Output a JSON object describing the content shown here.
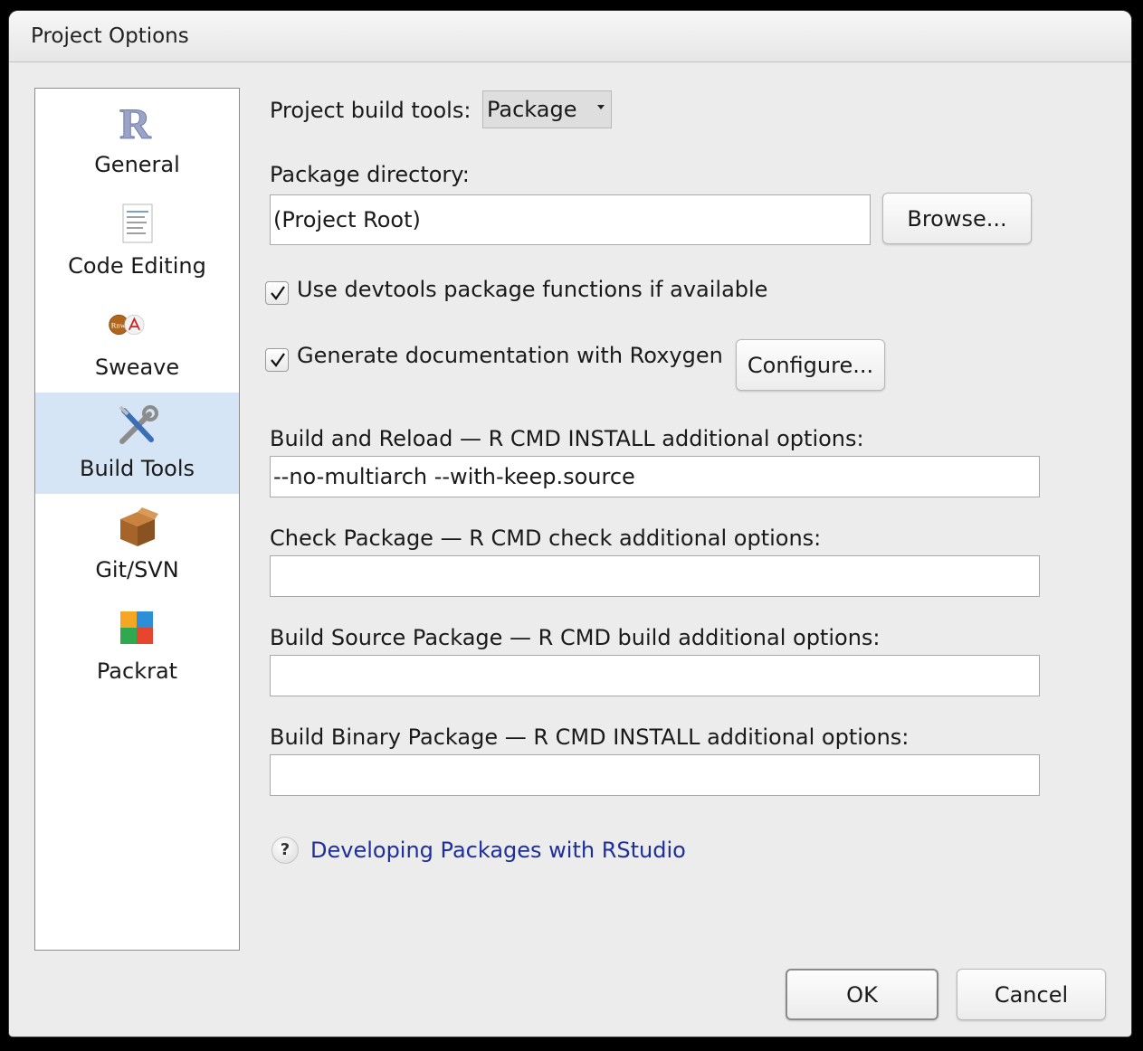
{
  "window": {
    "title": "Project Options"
  },
  "sidebar": {
    "items": [
      {
        "label": "General",
        "icon": "r-logo-icon",
        "selected": false
      },
      {
        "label": "Code Editing",
        "icon": "document-icon",
        "selected": false
      },
      {
        "label": "Sweave",
        "icon": "sweave-icon",
        "selected": false
      },
      {
        "label": "Build Tools",
        "icon": "tools-icon",
        "selected": true
      },
      {
        "label": "Git/SVN",
        "icon": "box-icon",
        "selected": false
      },
      {
        "label": "Packrat",
        "icon": "packrat-icon",
        "selected": false
      }
    ],
    "icon_texts": {
      "r": "R",
      "rnw": "Rnw"
    }
  },
  "build_tools": {
    "project_build_tools_label": "Project build tools:",
    "project_build_tools_value": "Package",
    "package_directory_label": "Package directory:",
    "package_directory_value": "(Project Root)",
    "browse_label": "Browse...",
    "use_devtools_label": "Use devtools package functions if available",
    "use_devtools_checked": true,
    "roxygen_label": "Generate documentation with Roxygen",
    "roxygen_checked": true,
    "configure_label": "Configure...",
    "build_reload_label": "Build and Reload — R CMD INSTALL additional options:",
    "build_reload_value": "--no-multiarch --with-keep.source",
    "check_label": "Check Package — R CMD check additional options:",
    "check_value": "",
    "build_source_label": "Build Source Package — R CMD build additional options:",
    "build_source_value": "",
    "build_binary_label": "Build Binary Package — R CMD INSTALL additional options:",
    "build_binary_value": "",
    "help_symbol": "?",
    "help_link": "Developing Packages with RStudio"
  },
  "footer": {
    "ok_label": "OK",
    "cancel_label": "Cancel"
  },
  "colors": {
    "selected_bg": "#d5e5f6",
    "link": "#1e2f9c",
    "window_bg": "#ececec"
  }
}
